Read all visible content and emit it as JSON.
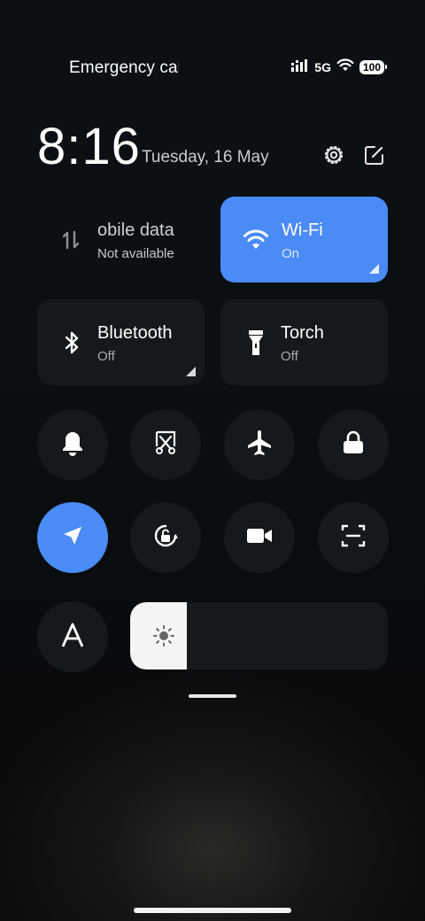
{
  "status_bar": {
    "carrier": "Emergency calls only",
    "network": "5G",
    "battery": "100"
  },
  "header": {
    "time": "8:16",
    "date": "Tuesday, 16 May"
  },
  "tiles": {
    "mobile_data": {
      "label": "Mobile data",
      "visible_label": "obile data",
      "status": "Not available"
    },
    "wifi": {
      "label": "Wi-Fi",
      "status": "On"
    },
    "bluetooth": {
      "label": "Bluetooth",
      "status": "Off"
    },
    "torch": {
      "label": "Torch",
      "status": "Off"
    }
  },
  "brightness": {
    "level": 0.22
  },
  "colors": {
    "accent": "#4a8bf5",
    "tile_bg": "#15191c",
    "background": "#0a0f13"
  },
  "icons": [
    "data-arrows-icon",
    "wifi-icon",
    "bluetooth-icon",
    "torch-icon",
    "bell-icon",
    "screenshot-icon",
    "airplane-icon",
    "lock-icon",
    "location-icon",
    "rotation-lock-icon",
    "video-icon",
    "scan-icon",
    "font-icon",
    "sun-icon",
    "gear-icon",
    "edit-icon"
  ]
}
